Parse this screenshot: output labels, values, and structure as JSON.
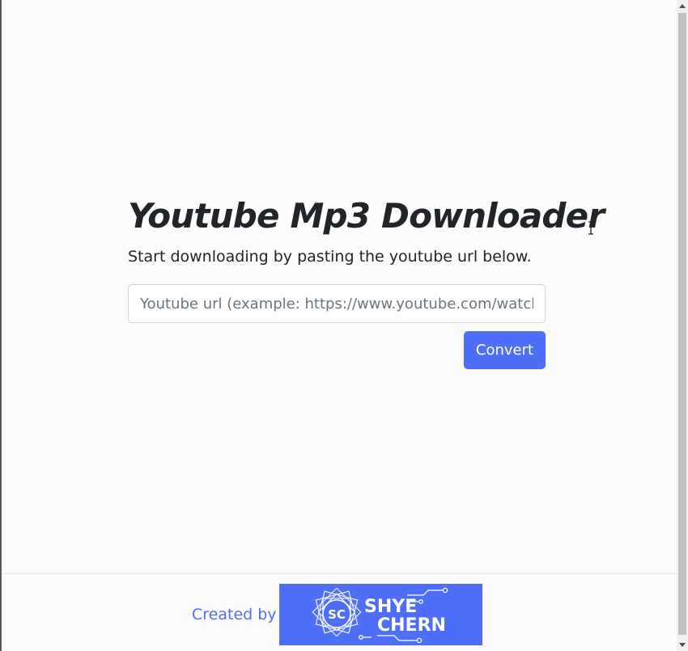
{
  "app": {
    "title": "Youtube Mp3 Downloader",
    "subtitle": "Start downloading by pasting the youtube url below."
  },
  "form": {
    "url_placeholder": "Youtube url (example: https://www.youtube.com/watch",
    "url_value": "",
    "convert_label": "Convert"
  },
  "footer": {
    "credit_label": "Created by",
    "logo": {
      "initials": "SC",
      "name_line1": "SHYE",
      "name_line2": "CHERN"
    }
  },
  "colors": {
    "accent": "#4f6ef7",
    "text": "#212529",
    "background": "#fcfcfd"
  },
  "icons": {
    "cursor": "text-cursor-icon",
    "logo_mark": "geometric-diamond-icon",
    "circuit": "circuit-lines-icon"
  }
}
